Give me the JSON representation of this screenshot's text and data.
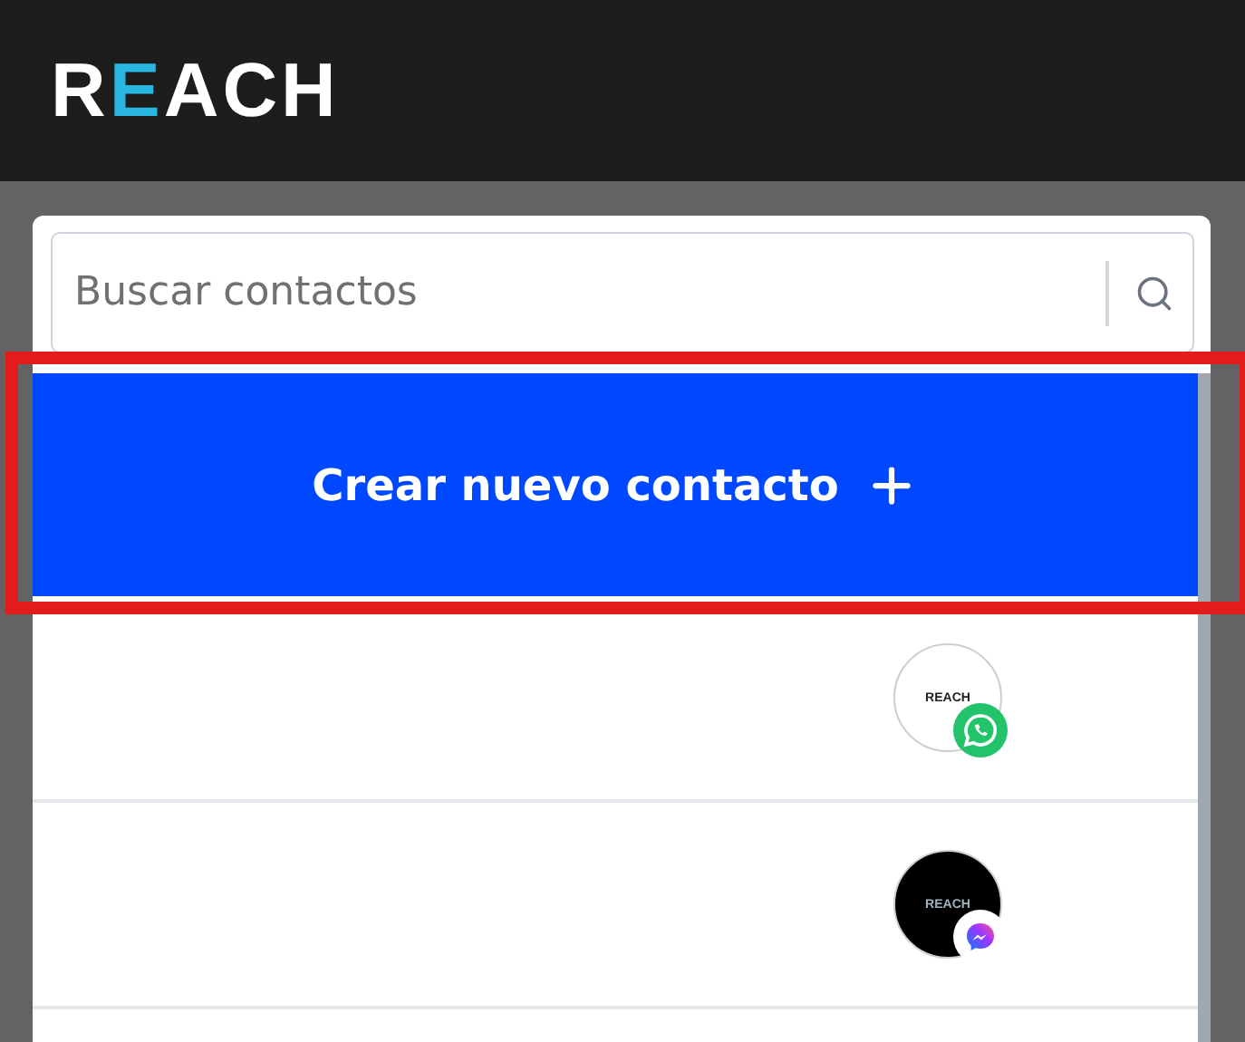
{
  "logo": {
    "parts": [
      {
        "text": "R",
        "accent": false
      },
      {
        "text": "E",
        "accent": true
      },
      {
        "text": "ACH",
        "accent": false
      }
    ]
  },
  "search": {
    "placeholder": "Buscar contactos"
  },
  "create_button": {
    "label": "Crear nuevo contacto",
    "highlighted": true
  },
  "contacts": [
    {
      "avatar": {
        "kind": "light",
        "text": "REACH"
      },
      "badge": {
        "kind": "whatsapp"
      }
    },
    {
      "avatar": {
        "kind": "dark",
        "text": "REACH"
      },
      "badge": {
        "kind": "messenger"
      }
    }
  ]
}
